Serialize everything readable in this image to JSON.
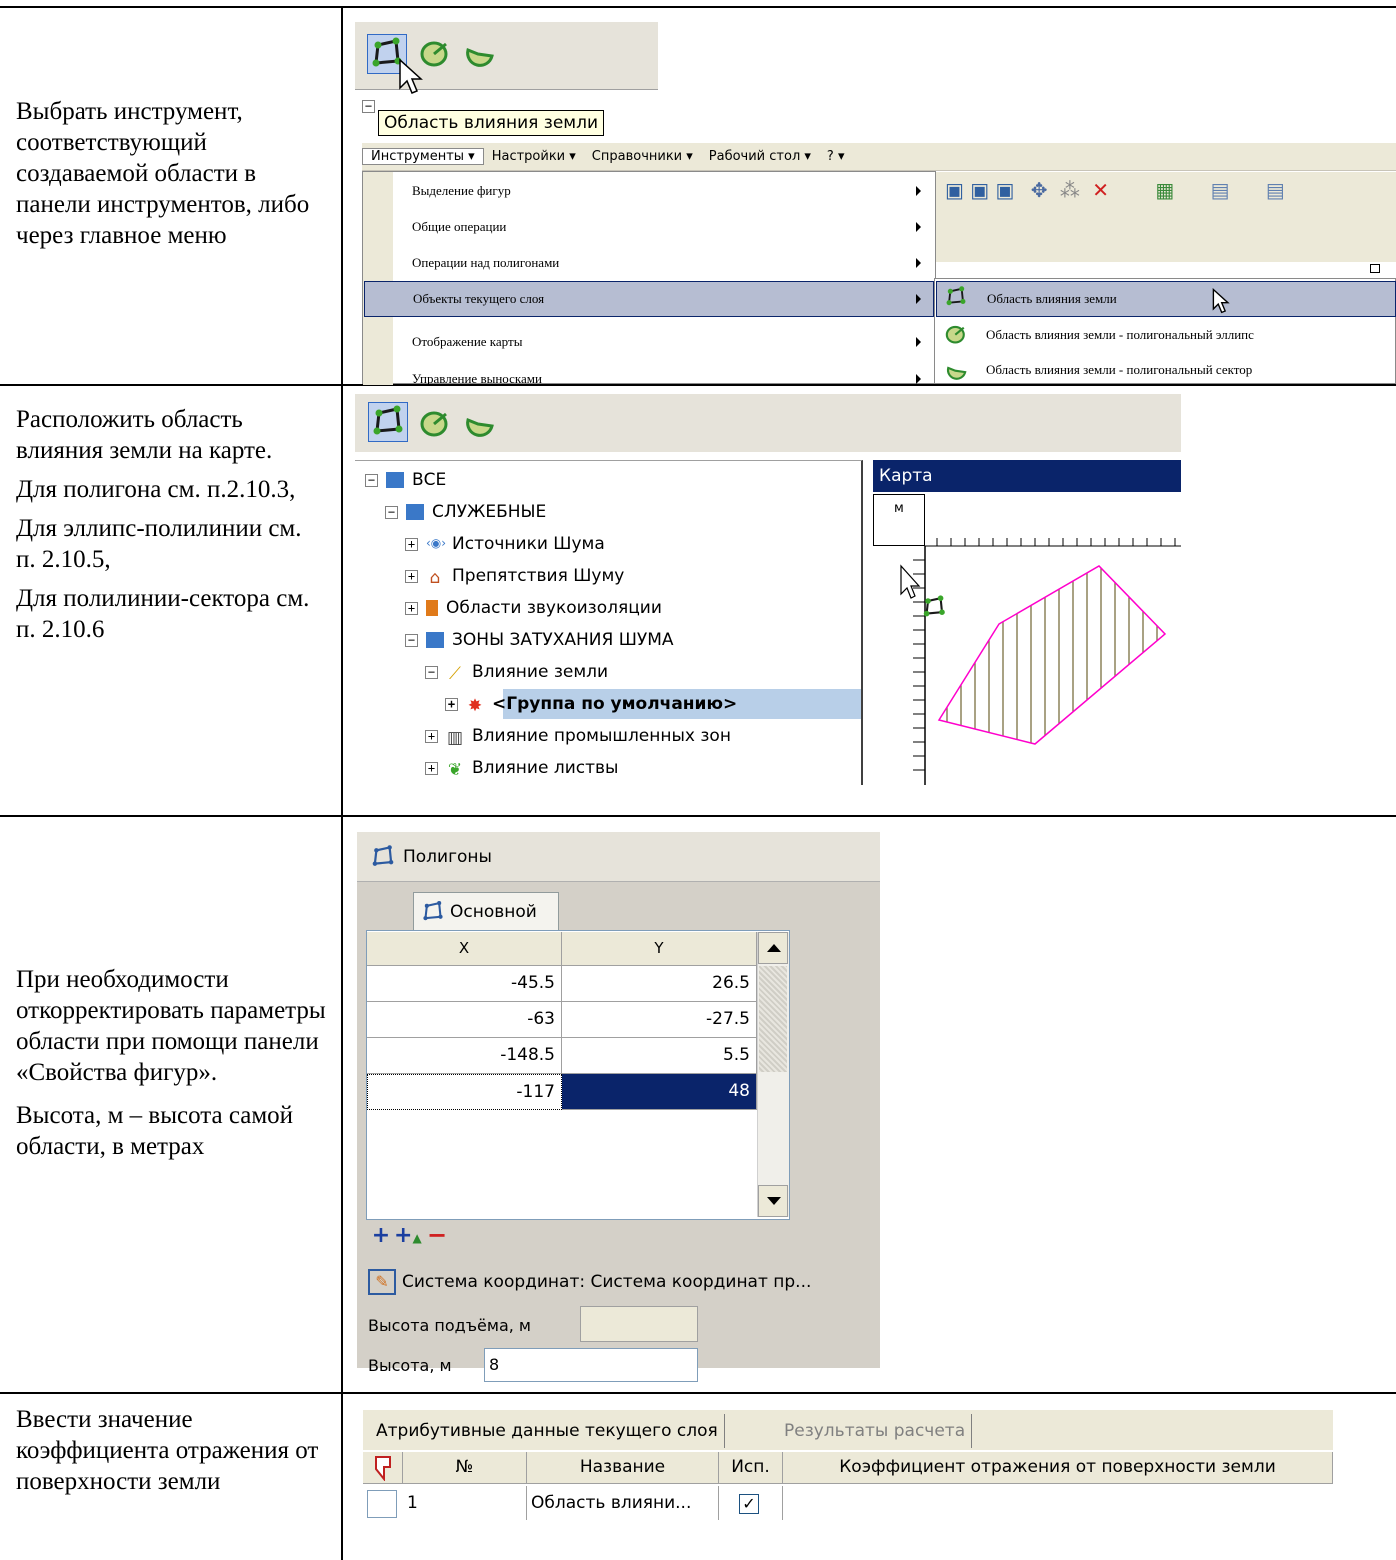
{
  "rows": [
    {
      "desc": [
        "Выбрать инструмент, соответствующий создаваемой области в панели инструментов, либо через главное меню"
      ],
      "tooltip": "Область влияния земли",
      "menubar": [
        "Инструменты ▾",
        "Настройки ▾",
        "Справочники ▾",
        "Рабочий стол ▾",
        "? ▾"
      ],
      "menu_items": [
        "Выделение фигур",
        "Общие операции",
        "Операции над полигонами",
        "Объекты текущего слоя",
        "Отображение карты",
        "Управление выносками"
      ],
      "submenu_items": [
        "Область влияния земли",
        "Область влияния земли - полигональный эллипс",
        "Область влияния земли - полигональный сектор"
      ]
    },
    {
      "desc": [
        "Расположить область влияния земли на карте.",
        "Для полигона см. п.2.10.3,",
        "Для эллипс-полилинии см. п. 2.10.5,",
        "Для полилинии-сектора см. п. 2.10.6"
      ],
      "tree": [
        "ВСЕ",
        "СЛУЖЕБНЫЕ",
        "Источники Шума",
        "Препятствия Шуму",
        "Области звукоизоляции",
        "ЗОНЫ ЗАТУХАНИЯ ШУМА",
        "Влияние земли",
        "<Группа по умолчанию>",
        "Влияние промышленных зон",
        "Влияние листвы"
      ],
      "map_title": "Карта",
      "ruler_unit": "м"
    },
    {
      "desc": [
        "При необходимости откорректировать параметры области при помощи панели «Свойства фигур».",
        "Высота, м – высота самой области, в метрах"
      ],
      "panel_title": "Полигоны",
      "tab": "Основной",
      "columns": [
        "X",
        "Y"
      ],
      "coords": [
        [
          "-45.5",
          "26.5"
        ],
        [
          "-63",
          "-27.5"
        ],
        [
          "-148.5",
          "5.5"
        ],
        [
          "-117",
          "48"
        ]
      ],
      "crs": "Система координат: Система координат пр...",
      "lift_label": "Высота подъёма, м",
      "lift_value": "",
      "height_label": "Высота, м",
      "height_value": "8"
    },
    {
      "desc": [
        "Ввести значение коэффициента отражения от поверхности земли"
      ],
      "tabs": [
        "Атрибутивные данные текущего слоя",
        "Результаты расчета"
      ],
      "columns": [
        "№",
        "Название",
        "Исп.",
        "Коэффициент отражения от поверхности земли"
      ],
      "row": [
        "1",
        "Область влияни...",
        "",
        ""
      ]
    }
  ],
  "colors": {
    "selection": "#0a246a",
    "polygon_edge": "#ff00cc",
    "hatch": "#7a7040"
  }
}
